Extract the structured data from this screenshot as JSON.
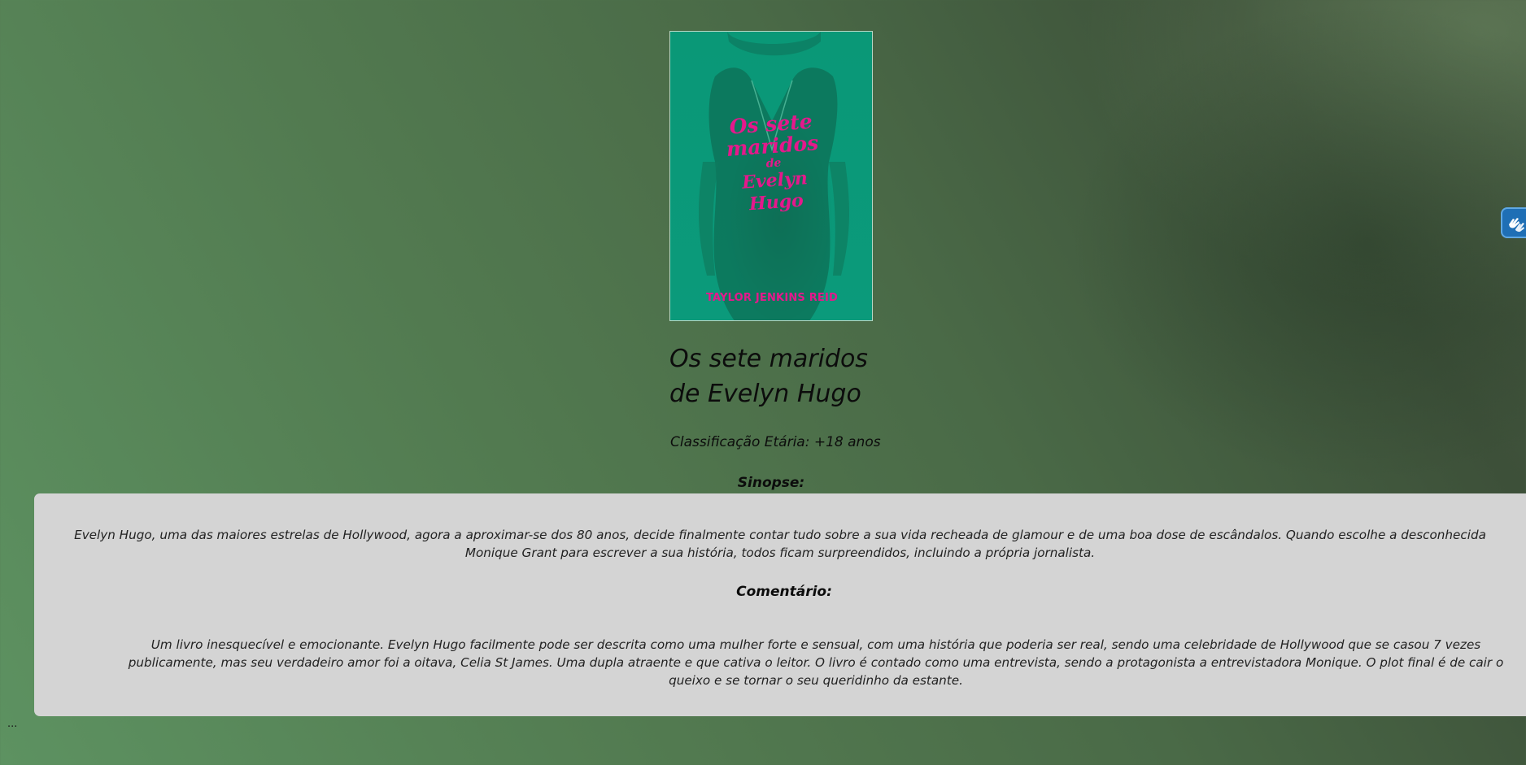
{
  "book": {
    "cover": {
      "title_lines": [
        "Os sete",
        "maridos",
        "de",
        "Evelyn Hugo"
      ],
      "author": "TAYLOR JENKINS REID",
      "background_color": "#0b9a7b",
      "text_color": "#e5188c"
    },
    "title_line1": "Os sete maridos",
    "title_line2": "de Evelyn Hugo",
    "age_rating": "Classificação Etária: +18 anos"
  },
  "synopsis": {
    "heading": "Sinopse:",
    "text": "Evelyn Hugo, uma das maiores estrelas de Hollywood, agora a aproximar-se dos 80 anos, decide finalmente contar tudo sobre a sua vida recheada de glamour e de uma boa dose de escândalos. Quando escolhe a desconhecida Monique Grant para escrever a sua história, todos ficam surpreendidos, incluindo a própria jornalista."
  },
  "comment": {
    "heading": "Comentário:",
    "text": "Um livro inesquecível e emocionante. Evelyn Hugo facilmente pode ser descrita como uma mulher forte e sensual, com uma história que poderia ser real, sendo uma celebridade de Hollywood que se casou 7 vezes publicamente, mas seu verdadeiro amor foi a oitava, Celia St James. Uma dupla atraente e que cativa o leitor. O livro é contado como uma entrevista, sendo a protagonista a entrevistadora Monique. O plot final é de cair o queixo e se tornar o seu queridinho da estante."
  },
  "footer": {
    "ellipsis": "..."
  },
  "accessibility_widget": {
    "icon": "sign-language-hands-icon",
    "color": "#1f6fb5"
  }
}
